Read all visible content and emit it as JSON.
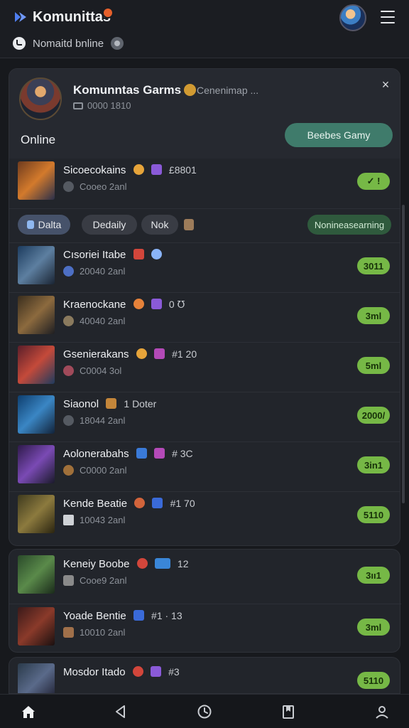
{
  "app": {
    "title": "Komunittas",
    "status_text": "Nomaitd bnline"
  },
  "group": {
    "title": "Komunntas Garms",
    "subtitle": "Cenenimap ...",
    "meta": "0000 1810",
    "online_label": "Online",
    "join_label": "Beebes Gamy"
  },
  "filters": {
    "chips": [
      "Dalta",
      "Dedaily",
      "Nok"
    ],
    "sort_label": "Nonineasearning"
  },
  "featured": {
    "title": "Sicoecokains",
    "extra": "£8801",
    "meta": "Cooeo 2anl",
    "pill": "✓ !"
  },
  "rows": [
    {
      "title": "Cısoriei Itabe",
      "extra": "",
      "meta": "20040 2anl",
      "pill": "3011"
    },
    {
      "title": "Kraenockane",
      "extra": "0 ℧",
      "meta": "40040 2anl",
      "pill": "3ml"
    },
    {
      "title": "Gsenierakans",
      "extra": "#1 20",
      "meta": "C0004 3ol",
      "pill": "5ml"
    },
    {
      "title": "Siaonol",
      "extra": "1 Doter",
      "meta": "18044 2anl",
      "pill": "2000/"
    },
    {
      "title": "Aolonerabahs",
      "extra": "# 3C",
      "meta": "C0000 2anl",
      "pill": "3in1"
    },
    {
      "title": "Kende Beatie",
      "extra": "#1 70",
      "meta": "10043 2anl",
      "pill": "5110"
    }
  ],
  "rows2": [
    {
      "title": "Keneiy Boobe",
      "extra": "12",
      "meta": "Cooe9 2anl",
      "pill": "3ıı1"
    },
    {
      "title": "Yoade Bentie",
      "extra": "#1 · 13",
      "meta": "10010 2anl",
      "pill": "3ml"
    }
  ],
  "rows3": [
    {
      "title": "Mosdor Itado",
      "extra": "#3",
      "meta": "",
      "pill": "5110"
    }
  ],
  "nav": [
    "home-icon",
    "back-icon",
    "clock-icon",
    "bookmark-icon",
    "profile-icon"
  ],
  "colors": {
    "accent_green": "#76b846",
    "join_button": "#3f7b6b",
    "background": "#17191d"
  }
}
